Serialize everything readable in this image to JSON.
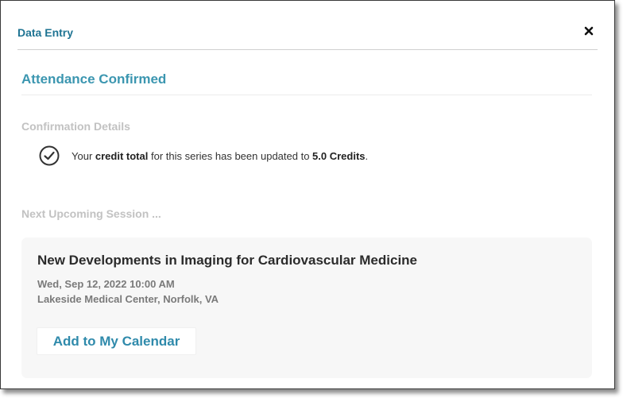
{
  "modal": {
    "title": "Data Entry",
    "close_icon": "close-icon"
  },
  "main": {
    "heading": "Attendance Confirmed",
    "confirmation": {
      "label": "Confirmation Details",
      "icon": "check-circle-icon",
      "text_before": "Your ",
      "text_bold_1": "credit total",
      "text_middle": " for this series has been updated to ",
      "text_bold_2": "5.0 Credits",
      "text_after": "."
    },
    "next_session": {
      "label": "Next Upcoming Session ...",
      "title": "New Developments in Imaging for Cardiovascular Medicine",
      "datetime": "Wed, Sep 12, 2022 10:00 AM",
      "location": "Lakeside Medical Center, Norfolk, VA",
      "calendar_button": "Add to My Calendar"
    }
  },
  "colors": {
    "accent": "#1f7493",
    "heading": "#3b96b0",
    "muted_label": "#c2c2c2",
    "card_bg": "#f7f7f7"
  }
}
